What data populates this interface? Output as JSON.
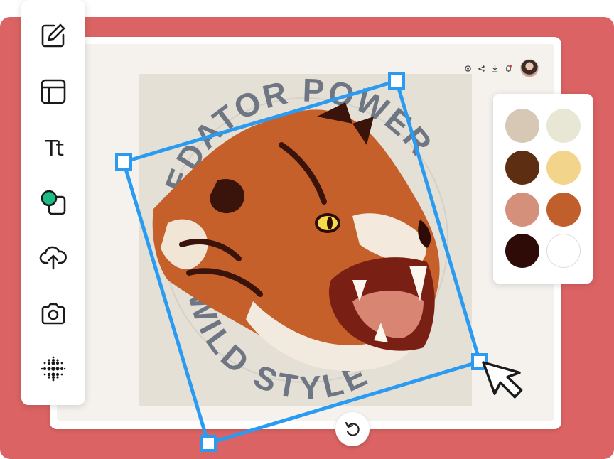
{
  "app": {
    "toolbar": {
      "tools": [
        {
          "icon": "edit-icon"
        },
        {
          "icon": "layout-icon"
        },
        {
          "icon": "text-icon",
          "label": "Tt"
        },
        {
          "icon": "shapes-icon"
        },
        {
          "icon": "upload-icon"
        },
        {
          "icon": "camera-icon"
        },
        {
          "icon": "halftone-icon"
        }
      ]
    },
    "topbar": {
      "icons": [
        "settings-icon",
        "share-icon",
        "download-icon",
        "notification-icon"
      ]
    },
    "artwork": {
      "arc_text_top": "PREDATOR POWER",
      "arc_text_bottom": "WILD STYLE"
    },
    "palette": {
      "colors": [
        "#d6c8b5",
        "#e8e6d5",
        "#5e2e12",
        "#f2d48a",
        "#d4907b",
        "#c15f2c",
        "#2e0b07",
        "#ffffff"
      ]
    },
    "accent": "#2b9bf2",
    "backdrop_color": "#db6363",
    "rotate_button": {
      "icon": "rotate-icon"
    }
  }
}
